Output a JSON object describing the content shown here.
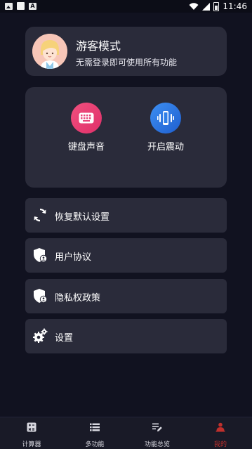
{
  "status_bar": {
    "time": "11:46",
    "left_icons": [
      "image-icon",
      "square-icon",
      "a-icon"
    ],
    "right_icons": [
      "wifi-icon",
      "signal-icon",
      "battery-icon"
    ]
  },
  "profile": {
    "title": "游客模式",
    "subtitle": "无需登录即可使用所有功能"
  },
  "toggles": [
    {
      "label": "键盘声音",
      "icon": "keyboard-icon",
      "color": "#e8457a"
    },
    {
      "label": "开启震动",
      "icon": "vibrate-icon",
      "color": "#2f7fe8"
    }
  ],
  "menu": [
    {
      "label": "恢复默认设置",
      "icon": "restore-icon"
    },
    {
      "label": "用户协议",
      "icon": "shield-user-icon"
    },
    {
      "label": "隐私权政策",
      "icon": "shield-user-icon"
    },
    {
      "label": "设置",
      "icon": "gear-icon"
    }
  ],
  "tabs": [
    {
      "label": "计算器",
      "icon": "calculator-icon",
      "active": false
    },
    {
      "label": "多功能",
      "icon": "list-icon",
      "active": false
    },
    {
      "label": "功能总览",
      "icon": "edit-list-icon",
      "active": false
    },
    {
      "label": "我的",
      "icon": "person-icon",
      "active": true
    }
  ],
  "colors": {
    "background": "#111220",
    "card": "#2a2b3a",
    "active_tab": "#c0302c"
  }
}
